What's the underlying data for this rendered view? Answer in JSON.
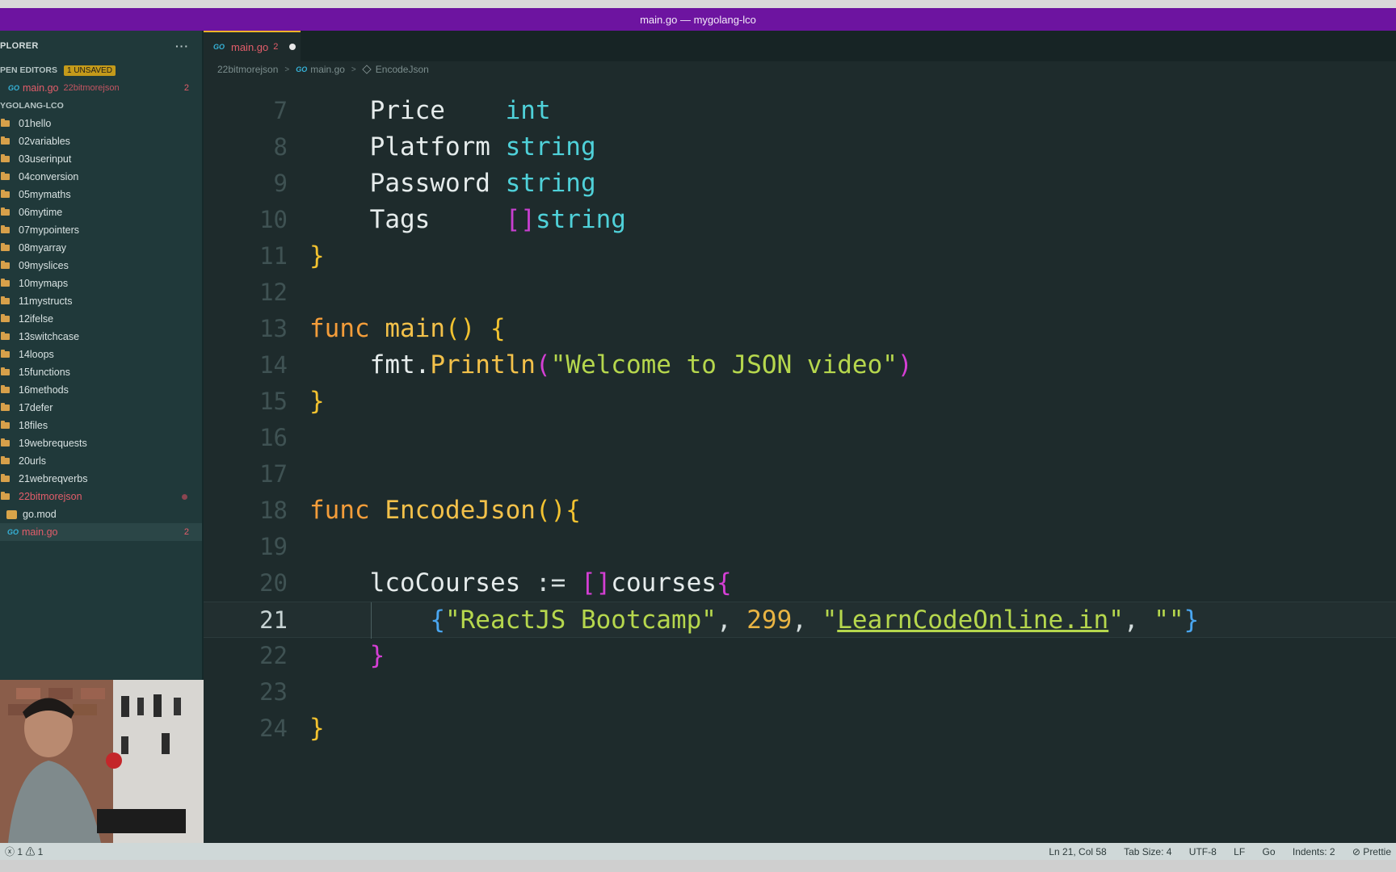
{
  "window": {
    "title": "main.go — mygolang-lco"
  },
  "sidebar": {
    "header": "PLORER",
    "more": "···",
    "open_editors": {
      "label": "PEN EDITORS",
      "badge": "1 UNSAVED"
    },
    "open_file": {
      "name": "main.go",
      "folder": "22bitmorejson",
      "count": "2"
    },
    "workspace": "YGOLANG-LCO",
    "folders": [
      "01hello",
      "02variables",
      "03userinput",
      "04conversion",
      "05mymaths",
      "06mytime",
      "07mypointers",
      "08myarray",
      "09myslices",
      "10mymaps",
      "11mystructs",
      "12ifelse",
      "13switchcase",
      "14loops",
      "15functions",
      "16methods",
      "17defer",
      "18files",
      "19webrequests",
      "20urls",
      "21webreqverbs"
    ],
    "active_folder": "22bitmorejson",
    "children": [
      {
        "name": "go.mod"
      },
      {
        "name": "main.go",
        "count": "2"
      }
    ]
  },
  "editor": {
    "tab": {
      "label": "main.go",
      "count": "2"
    },
    "breadcrumb": [
      "22bitmorejson",
      "main.go",
      "EncodeJson"
    ],
    "lines": [
      {
        "n": "7"
      },
      {
        "n": "8"
      },
      {
        "n": "9"
      },
      {
        "n": "10"
      },
      {
        "n": "11"
      },
      {
        "n": "12"
      },
      {
        "n": "13"
      },
      {
        "n": "14"
      },
      {
        "n": "15"
      },
      {
        "n": "16"
      },
      {
        "n": "17"
      },
      {
        "n": "18"
      },
      {
        "n": "19"
      },
      {
        "n": "20"
      },
      {
        "n": "21"
      },
      {
        "n": "22"
      },
      {
        "n": "23"
      },
      {
        "n": "24"
      }
    ]
  },
  "statusbar": {
    "problems": "ⓧ 1 ⚠ 1",
    "position": "Ln 21, Col 58",
    "tab_size": "Tab Size: 4",
    "encoding": "UTF-8",
    "eol": "LF",
    "language": "Go",
    "indents": "Indents: 2",
    "prettier": "⊘ Prettie"
  },
  "colors": {
    "title_bar": "#6d14a0",
    "sidebar_bg": "#20393a",
    "editor_bg": "#1e2b2c",
    "error": "#e35d6a"
  }
}
